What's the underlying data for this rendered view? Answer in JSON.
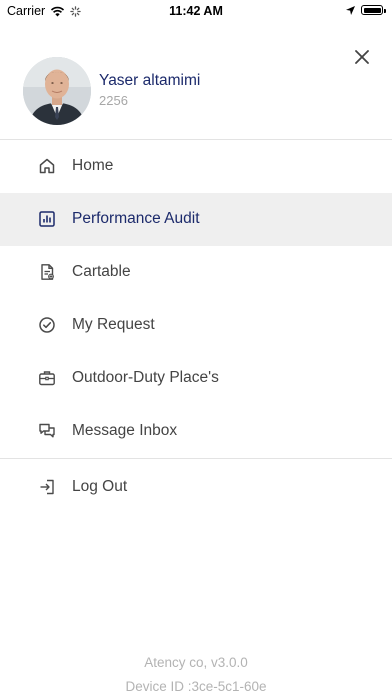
{
  "status_bar": {
    "carrier": "Carrier",
    "time": "11:42 AM"
  },
  "profile": {
    "name": "Yaser altamimi",
    "id": "2256"
  },
  "menu": {
    "items": [
      {
        "label": "Home",
        "icon": "home-icon"
      },
      {
        "label": "Performance Audit",
        "icon": "bar-chart-icon",
        "active": true
      },
      {
        "label": "Cartable",
        "icon": "document-icon"
      },
      {
        "label": "My Request",
        "icon": "check-circle-icon"
      },
      {
        "label": "Outdoor-Duty Place's",
        "icon": "briefcase-icon"
      },
      {
        "label": "Message Inbox",
        "icon": "chat-icon"
      }
    ],
    "logout_label": "Log Out"
  },
  "footer": {
    "version": "Atency co, v3.0.0",
    "device_id": "Device ID :3ce-5c1-60e"
  },
  "colors": {
    "accent": "#1c2a6b",
    "active_bg": "#efefef",
    "text": "#444444",
    "muted": "#b3b3b3"
  }
}
